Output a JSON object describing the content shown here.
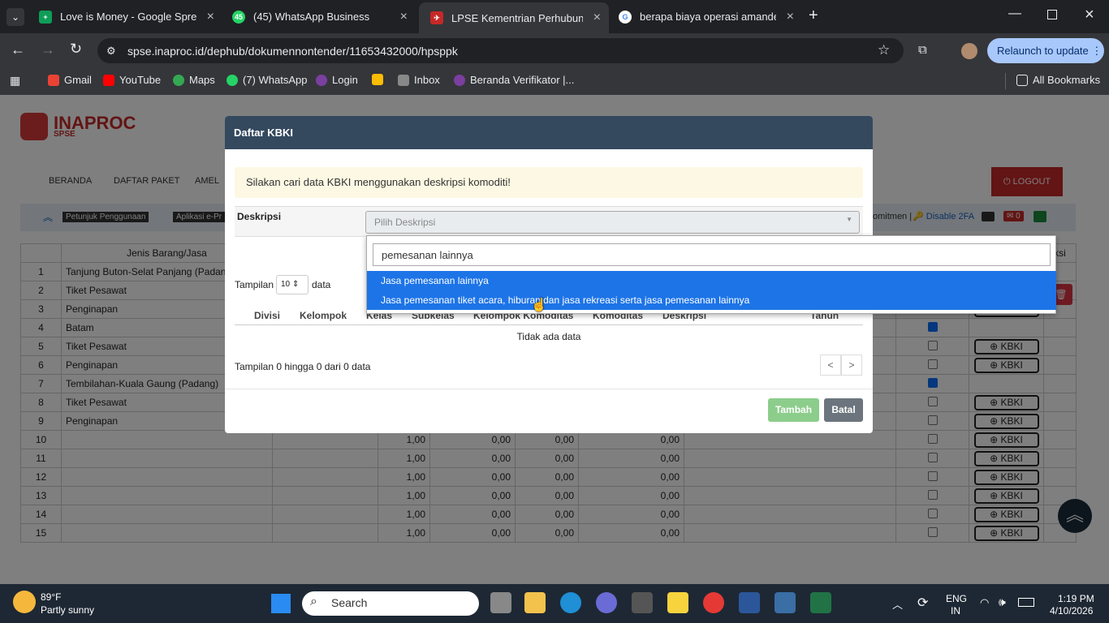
{
  "browser": {
    "tabs": [
      {
        "title": "Love is Money - Google Spread",
        "icon": "sheets-icon",
        "color": "#0f9d58"
      },
      {
        "title": "(45) WhatsApp Business",
        "icon": "whatsapp-icon",
        "color": "#25d366",
        "badge": "45"
      },
      {
        "title": "LPSE Kementrian Perhubungan",
        "icon": "lpse-icon",
        "color": "#c62828"
      },
      {
        "title": "berapa biaya operasi amandel",
        "icon": "google-icon",
        "color": "#4285f4"
      }
    ],
    "url": "spse.inaproc.id/dephub/dokumennontender/11653432000/hpsppk",
    "relaunch": "Relaunch to update",
    "bookmarks": [
      {
        "label": "Gmail",
        "color": "#ea4335"
      },
      {
        "label": "YouTube",
        "color": "#ff0000"
      },
      {
        "label": "Maps",
        "color": "#34a853"
      },
      {
        "label": "(7) WhatsApp",
        "color": "#25d366"
      },
      {
        "label": "Login",
        "color": "#7b3fa0"
      },
      {
        "label": "",
        "color": "#fbbc04"
      },
      {
        "label": "Inbox",
        "color": "#888888"
      },
      {
        "label": "Beranda Verifikator |...",
        "color": "#7b3fa0"
      }
    ],
    "all_bookmarks": "All Bookmarks"
  },
  "site": {
    "logo": "INAPROC",
    "logo_sub": "SPSE",
    "nav": [
      "BERANDA",
      "DAFTAR PAKET",
      "AMEL"
    ],
    "logout": "LOGOUT",
    "petunjuk": "Petunjuk Penggunaan",
    "aplikasi": "Aplikasi e-Pr",
    "komitmen": "omitmen |",
    "disable2fa": "Disable 2FA",
    "mail_count": "0",
    "col_jenis": "Jenis Barang/Jasa",
    "col_aksi": "ksi",
    "rows": [
      {
        "no": "1",
        "name": "Tanjung Buton-Selat Panjang (Padang)"
      },
      {
        "no": "2",
        "name": "Tiket Pesawat"
      },
      {
        "no": "3",
        "name": "Penginapan"
      },
      {
        "no": "4",
        "name": "Batam"
      },
      {
        "no": "5",
        "name": "Tiket Pesawat"
      },
      {
        "no": "6",
        "name": "Penginapan"
      },
      {
        "no": "7",
        "name": "Tembilahan-Kuala Gaung (Padang)"
      },
      {
        "no": "8",
        "name": "Tiket Pesawat"
      },
      {
        "no": "9",
        "name": "Penginapan"
      },
      {
        "no": "10",
        "name": ""
      },
      {
        "no": "11",
        "name": ""
      },
      {
        "no": "12",
        "name": ""
      },
      {
        "no": "13",
        "name": ""
      },
      {
        "no": "14",
        "name": ""
      },
      {
        "no": "15",
        "name": ""
      }
    ],
    "num_qty": "1,00",
    "num_zero": "0,00",
    "kbki_label": "KBKI"
  },
  "modal": {
    "title": "Daftar KBKI",
    "alert": "Silakan cari data KBKI menggunakan deskripsi komoditi!",
    "deskripsi_label": "Deskripsi",
    "select_placeholder": "Pilih Deskripsi",
    "tampilan": "Tampilan",
    "page_size": "10",
    "data": "data",
    "columns": [
      "Divisi",
      "Kelompok",
      "Kelas",
      "Subkelas",
      "Kelompok Komoditas",
      "Komoditas",
      "Deskripsi",
      "Tahun"
    ],
    "empty": "Tidak ada data",
    "info": "Tampilan 0 hingga 0 dari 0 data",
    "prev": "<",
    "next": ">",
    "tambah": "Tambah",
    "batal": "Batal"
  },
  "dropdown": {
    "search_value": "pemesanan lainnya",
    "options": [
      "Jasa pemesanan lainnya",
      "Jasa pemesanan tiket acara, hiburan dan jasa rekreasi serta jasa pemesanan lainnya"
    ]
  },
  "taskbar": {
    "temp": "89°F",
    "weather": "Partly sunny",
    "search": "Search",
    "lang1": "ENG",
    "lang2": "IN",
    "time": "1:19 PM",
    "date": "4/10/2026"
  }
}
